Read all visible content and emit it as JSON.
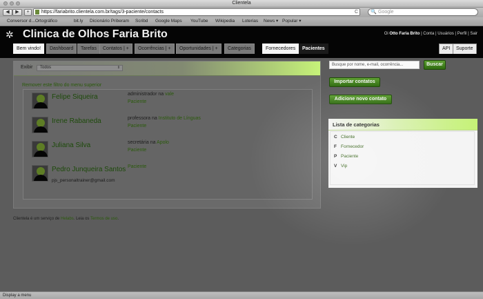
{
  "window": {
    "title": "Clientela"
  },
  "browser": {
    "back_label": "◀",
    "forward_label": "▶",
    "add_label": "+",
    "url": "https://fariabrito.clientela.com.br/tags/3-paciente/contacts",
    "reload_icon": "C",
    "search_placeholder": "Google",
    "bookmarks": [
      "Conversor d...Ortográfico",
      "bit.ly",
      "Dicionário Priberam",
      "Scribd",
      "Google Maps",
      "YouTube",
      "Wikipedia",
      "Loterias",
      "News ▾",
      "Popular ▾"
    ]
  },
  "header": {
    "brand": "Clinica de Olhos Faria Brito",
    "greeting": "Oi",
    "user": "Otto Faria Brito",
    "links": "| Conta | Usuários | Perfil | Sair"
  },
  "tabs": {
    "bem_vindo": "Bem vindo!",
    "dashboard": "Dashboard",
    "tarefas": "Tarefas",
    "contatos": "Contatos | +",
    "ocorrencias": "Ocorrências | +",
    "oportunidades": "Oportunidades | +",
    "categorias": "Categorias",
    "fornecedores": "Fornecedores",
    "pacientes": "Pacientes",
    "api": "API",
    "suporte": "Suporte"
  },
  "filter": {
    "label": "Exibir",
    "value": "Todos",
    "remove_link": "Remover este filtro do menu superior"
  },
  "contacts": [
    {
      "name": "Felipe Siqueira",
      "role": "administrador",
      "prep": "na",
      "org": "vale",
      "category": "Paciente",
      "email": ""
    },
    {
      "name": "Irene Rabaneda",
      "role": "professora",
      "prep": "na",
      "org": "Instituto de Línguas",
      "category": "Paciente",
      "email": ""
    },
    {
      "name": "Juliana Silva",
      "role": "secretária",
      "prep": "na",
      "org": "Apolo",
      "category": "Paciente",
      "email": ""
    },
    {
      "name": "Pedro Junqueira Santos",
      "role": "",
      "prep": "",
      "org": "",
      "category": "Paciente",
      "email": "pjs_personaltrainer@gmail.com"
    }
  ],
  "footer": {
    "prefix": "Clientela é um serviço de",
    "helabs": "Helabs",
    "middle": ". Leia os",
    "terms": "Termos de uso",
    "suffix": "."
  },
  "sidebar": {
    "search_placeholder": "Busque por nome, e-mail, ocorrência...",
    "search_button": "Buscar",
    "import_button": "Importar contatos",
    "add_button": "Adicione novo contato",
    "categories_title": "Lista de categorias",
    "categories": [
      {
        "letter": "C",
        "label": "Cliente"
      },
      {
        "letter": "F",
        "label": "Fornecedor"
      },
      {
        "letter": "P",
        "label": "Paciente"
      },
      {
        "letter": "V",
        "label": "Vip"
      }
    ]
  },
  "status": {
    "text": "Display a menu"
  },
  "colors": {
    "accent_green": "#2f6b10",
    "highlight_lime": "#c5f276",
    "header_black": "#050505"
  }
}
